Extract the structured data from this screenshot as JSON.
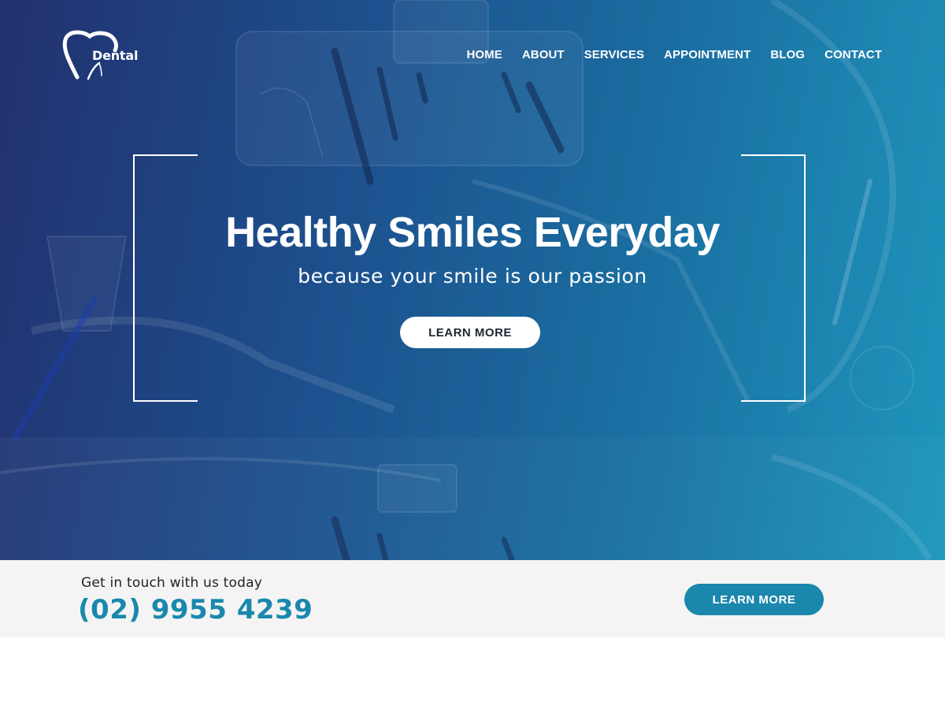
{
  "brand": {
    "logo_text": "Dental"
  },
  "nav": {
    "items": [
      {
        "label": "HOME"
      },
      {
        "label": "ABOUT"
      },
      {
        "label": "SERVICES"
      },
      {
        "label": "APPOINTMENT"
      },
      {
        "label": "BLOG"
      },
      {
        "label": "CONTACT"
      }
    ]
  },
  "hero": {
    "title": "Healthy Smiles Everyday",
    "subtitle": "because your smile is our passion",
    "button_label": "LEARN MORE",
    "background_image": "dental-clinic-equipment"
  },
  "cta": {
    "label": "Get in touch with us today",
    "phone": "(02) 9955 4239",
    "button_label": "LEARN MORE"
  },
  "colors": {
    "accent": "#1a87ad",
    "hero_gradient_start": "#22306e",
    "hero_gradient_end": "#1f97bd",
    "strip_bg": "#f4f4f4"
  }
}
